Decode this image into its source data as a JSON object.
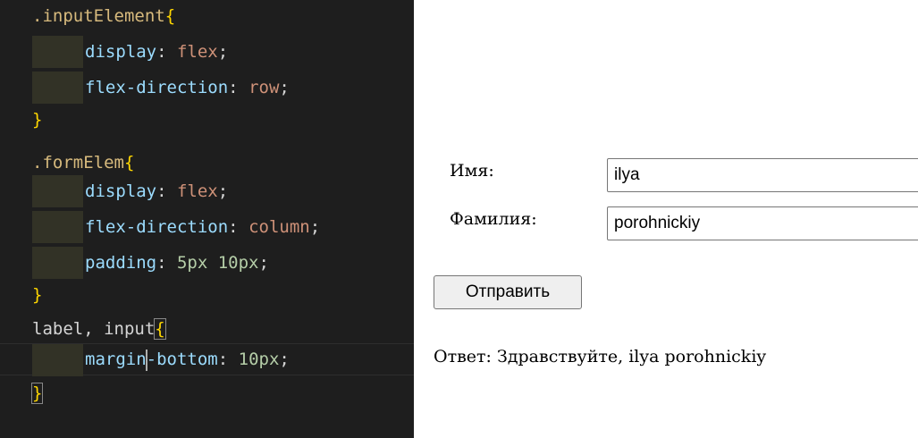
{
  "editor": {
    "lines": [
      {
        "selector": ".inputElement",
        "brace": "{"
      },
      {
        "property": "display",
        "colon": ":",
        "value": "flex",
        "semicolon": ";"
      },
      {
        "property": "flex-direction",
        "colon": ":",
        "value": "row",
        "semicolon": ";"
      },
      {
        "brace": "}"
      },
      {
        "selector": ".formElem",
        "brace": "{"
      },
      {
        "property": "display",
        "colon": ":",
        "value": "flex",
        "semicolon": ";"
      },
      {
        "property": "flex-direction",
        "colon": ":",
        "value": "column",
        "semicolon": ";"
      },
      {
        "property": "padding",
        "colon": ":",
        "value": "5px 10px",
        "semicolon": ";"
      },
      {
        "brace": "}"
      },
      {
        "selector": "label, input",
        "brace": "{"
      },
      {
        "property_before_cursor": "margin",
        "property_after_cursor": "-bottom",
        "colon": ":",
        "value": "10px",
        "semicolon": ";"
      },
      {
        "brace": "}"
      }
    ],
    "colors": {
      "background": "#1e1e1e",
      "selector": "#d7ba7d",
      "property": "#9cdcfe",
      "value": "#ce9178",
      "number": "#b5cea8",
      "brace": "#ffd700"
    }
  },
  "form": {
    "name_label": "Имя:",
    "name_value": "ilya",
    "surname_label": "Фамилия:",
    "surname_value": "porohnickiy",
    "submit_label": "Отправить",
    "answer_text": "Ответ: Здравствуйте, ilya porohnickiy"
  }
}
